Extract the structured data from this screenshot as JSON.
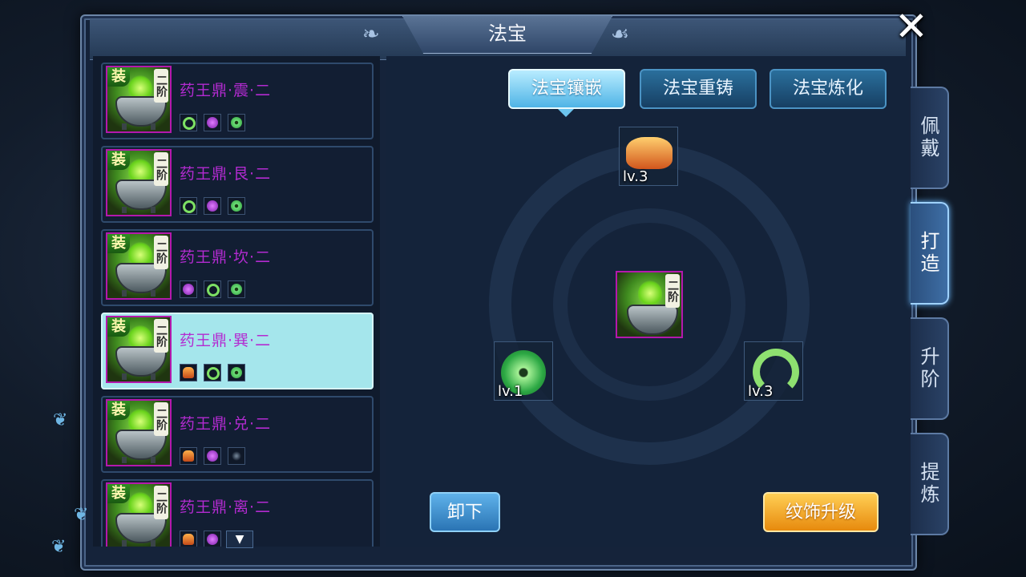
{
  "window": {
    "title": "法宝",
    "close_label": "✕"
  },
  "items": [
    {
      "badge": "装",
      "tier": "二阶",
      "name": "药王鼎·震·二",
      "gems": [
        "jade-ring",
        "purple",
        "jade-disc"
      ],
      "selected": false
    },
    {
      "badge": "装",
      "tier": "二阶",
      "name": "药王鼎·艮·二",
      "gems": [
        "jade-ring",
        "purple",
        "jade-disc"
      ],
      "selected": false
    },
    {
      "badge": "装",
      "tier": "二阶",
      "name": "药王鼎·坎·二",
      "gems": [
        "purple",
        "jade-ring",
        "jade-disc"
      ],
      "selected": false
    },
    {
      "badge": "装",
      "tier": "二阶",
      "name": "药王鼎·巽·二",
      "gems": [
        "orange",
        "jade-ring",
        "jade-disc"
      ],
      "selected": true
    },
    {
      "badge": "装",
      "tier": "二阶",
      "name": "药王鼎·兑·二",
      "gems": [
        "orange",
        "purple",
        "empty"
      ],
      "selected": false
    },
    {
      "badge": "装",
      "tier": "二阶",
      "name": "药王鼎·离·二",
      "gems": [
        "orange",
        "purple"
      ],
      "selected": false
    }
  ],
  "list_scroll_icon": "chevron-down-icon",
  "tabs": [
    {
      "label": "法宝镶嵌",
      "active": true
    },
    {
      "label": "法宝重铸",
      "active": false
    },
    {
      "label": "法宝炼化",
      "active": false
    }
  ],
  "slots": {
    "top": {
      "level": "lv.3",
      "icon": "orange-ornament-icon"
    },
    "left": {
      "level": "lv.1",
      "icon": "jade-disc-icon"
    },
    "right": {
      "level": "lv.3",
      "icon": "jade-ring-icon"
    },
    "center": {
      "tier": "二阶",
      "icon": "cauldron-icon"
    }
  },
  "buttons": {
    "unequip": "卸下",
    "upgrade": "纹饰升级"
  },
  "side_tabs": [
    {
      "label": "佩戴",
      "active": false
    },
    {
      "label": "打造",
      "active": true
    },
    {
      "label": "升阶",
      "active": false
    },
    {
      "label": "提炼",
      "active": false
    }
  ],
  "colors": {
    "item_name": "#b32bd1",
    "selected_row": "#a5e6ec",
    "upgrade_button": "#f2a623",
    "unequip_button": "#3f8fd0"
  }
}
